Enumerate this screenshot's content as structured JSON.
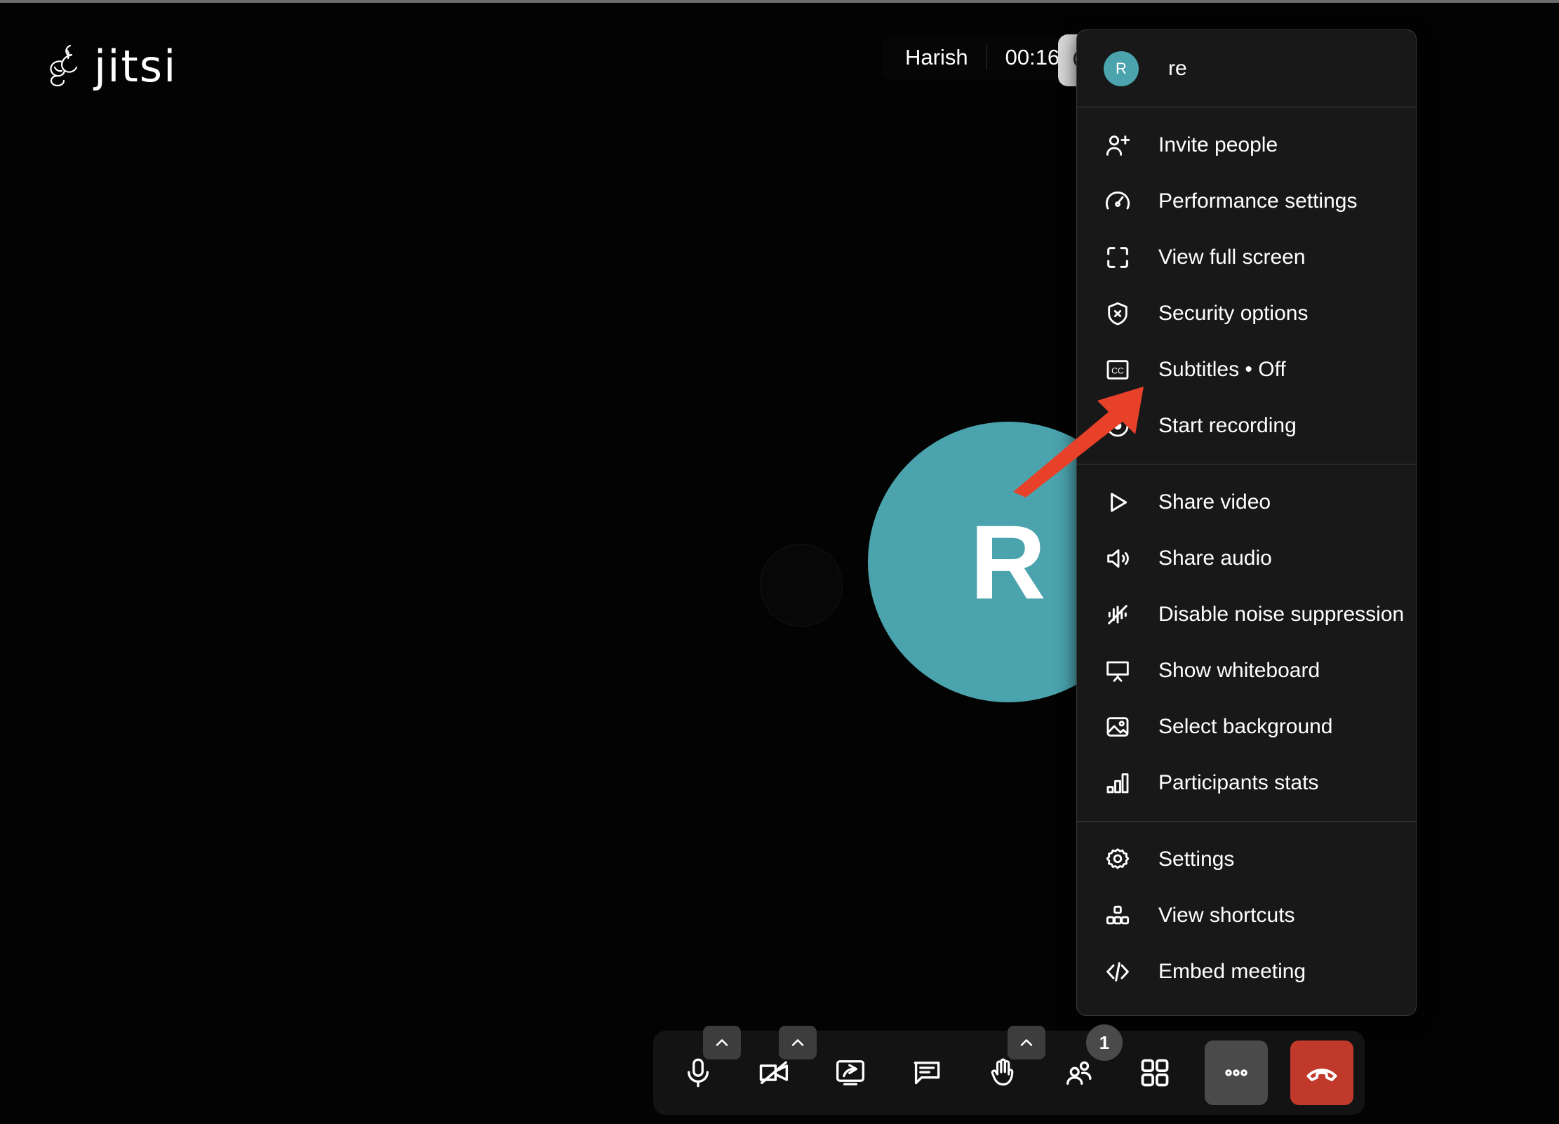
{
  "app": {
    "brand_name": "jitsi",
    "logo_icon": "jitsi-knot-logo"
  },
  "header": {
    "participant_name": "Harish",
    "meeting_timer": "00:16",
    "info_button_icon": "meeting-info-icon"
  },
  "stage": {
    "avatar_letter": "R",
    "avatar_color": "#4ba3ad",
    "background_color": "#030303"
  },
  "overflow_menu": {
    "header": {
      "avatar_letter": "R",
      "display_name": "re",
      "avatar_color": "#4ba3ad"
    },
    "groups": [
      {
        "items": [
          {
            "label": "Invite people",
            "icon": "add-person-icon"
          },
          {
            "label": "Performance settings",
            "icon": "gauge-icon"
          },
          {
            "label": "View full screen",
            "icon": "fullscreen-icon"
          },
          {
            "label": "Security options",
            "icon": "shield-x-icon"
          },
          {
            "label": "Subtitles • Off",
            "icon": "closed-caption-icon"
          },
          {
            "label": "Start recording",
            "icon": "record-icon"
          }
        ]
      },
      {
        "items": [
          {
            "label": "Share video",
            "icon": "play-triangle-icon"
          },
          {
            "label": "Share audio",
            "icon": "speaker-icon"
          },
          {
            "label": "Disable noise suppression",
            "icon": "noise-suppression-off-icon"
          },
          {
            "label": "Show whiteboard",
            "icon": "whiteboard-icon"
          },
          {
            "label": "Select background",
            "icon": "image-icon"
          },
          {
            "label": "Participants stats",
            "icon": "bar-chart-icon"
          }
        ]
      },
      {
        "items": [
          {
            "label": "Settings",
            "icon": "gear-icon"
          },
          {
            "label": "View shortcuts",
            "icon": "shortcuts-icon"
          },
          {
            "label": "Embed meeting",
            "icon": "code-brackets-icon"
          }
        ]
      }
    ]
  },
  "annotation": {
    "type": "arrow",
    "color": "#e8412a",
    "points_to": "Subtitles • Off"
  },
  "toolbar": {
    "background": "#131313",
    "buttons": [
      {
        "name": "microphone",
        "icon": "microphone-icon",
        "has_chevron": true,
        "state": "unmuted"
      },
      {
        "name": "camera",
        "icon": "video-off-icon",
        "has_chevron": true,
        "state": "off"
      },
      {
        "name": "screen-share",
        "icon": "screen-share-icon",
        "has_chevron": false
      },
      {
        "name": "chat",
        "icon": "chat-bubble-icon",
        "has_chevron": false
      },
      {
        "name": "raise-hand",
        "icon": "raised-hand-icon",
        "has_chevron": true
      },
      {
        "name": "participants",
        "icon": "participants-icon",
        "has_chevron": false,
        "badge": "1"
      },
      {
        "name": "tile-view",
        "icon": "grid-tiles-icon",
        "has_chevron": false
      },
      {
        "name": "more-options",
        "icon": "ellipsis-icon",
        "has_chevron": false,
        "active": true
      },
      {
        "name": "hangup",
        "icon": "phone-hangup-icon",
        "has_chevron": false,
        "color": "#c0392b"
      }
    ]
  }
}
